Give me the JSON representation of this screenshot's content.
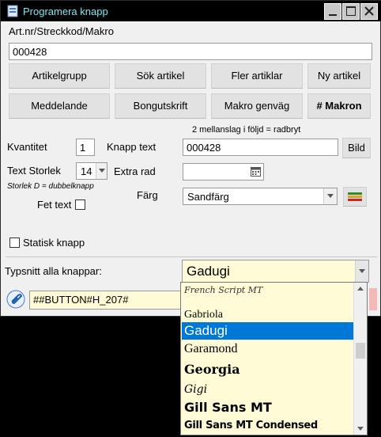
{
  "window": {
    "title": "Programera knapp"
  },
  "fields": {
    "artnr_label": "Art.nr/Streckkod/Makro",
    "artnr_value": "000428"
  },
  "buttons_row1": [
    "Artikelgrupp",
    "Sök artikel",
    "Fler artiklar",
    "Ny artikel"
  ],
  "buttons_row2": [
    "Meddelande",
    "Bongutskrift",
    "Makro genväg",
    "# Makron"
  ],
  "hint_radbryt": "2 mellanslag i följd = radbryt",
  "kvantitet": {
    "label": "Kvantitet",
    "value": "1"
  },
  "knapp_text": {
    "label": "Knapp text",
    "value": "000428",
    "bild_label": "Bild"
  },
  "text_storlek": {
    "label": "Text Storlek",
    "value": "14",
    "hint": "Storlek D = dubbelknapp"
  },
  "extra_rad": {
    "label": "Extra rad",
    "value": ""
  },
  "farg": {
    "label": "Färg",
    "value": "Sandfärg"
  },
  "fet_text": {
    "label": "Fet text",
    "checked": false
  },
  "statisk_knapp": {
    "label": "Statisk knapp",
    "checked": false
  },
  "typsnitt": {
    "label": "Typsnitt alla knappar:",
    "value": "Gadugi"
  },
  "macro_field": {
    "value": "##BUTTON#H_207#"
  },
  "font_list": [
    "French Script MT",
    "Gabriola",
    "Gadugi",
    "Garamond",
    "Georgia",
    "Gigi",
    "Gill Sans MT",
    "Gill Sans MT Condensed"
  ],
  "colors": {
    "title_text": "#7fe7f0",
    "selection": "#0078d7",
    "list_bg": "#fffbd6"
  }
}
